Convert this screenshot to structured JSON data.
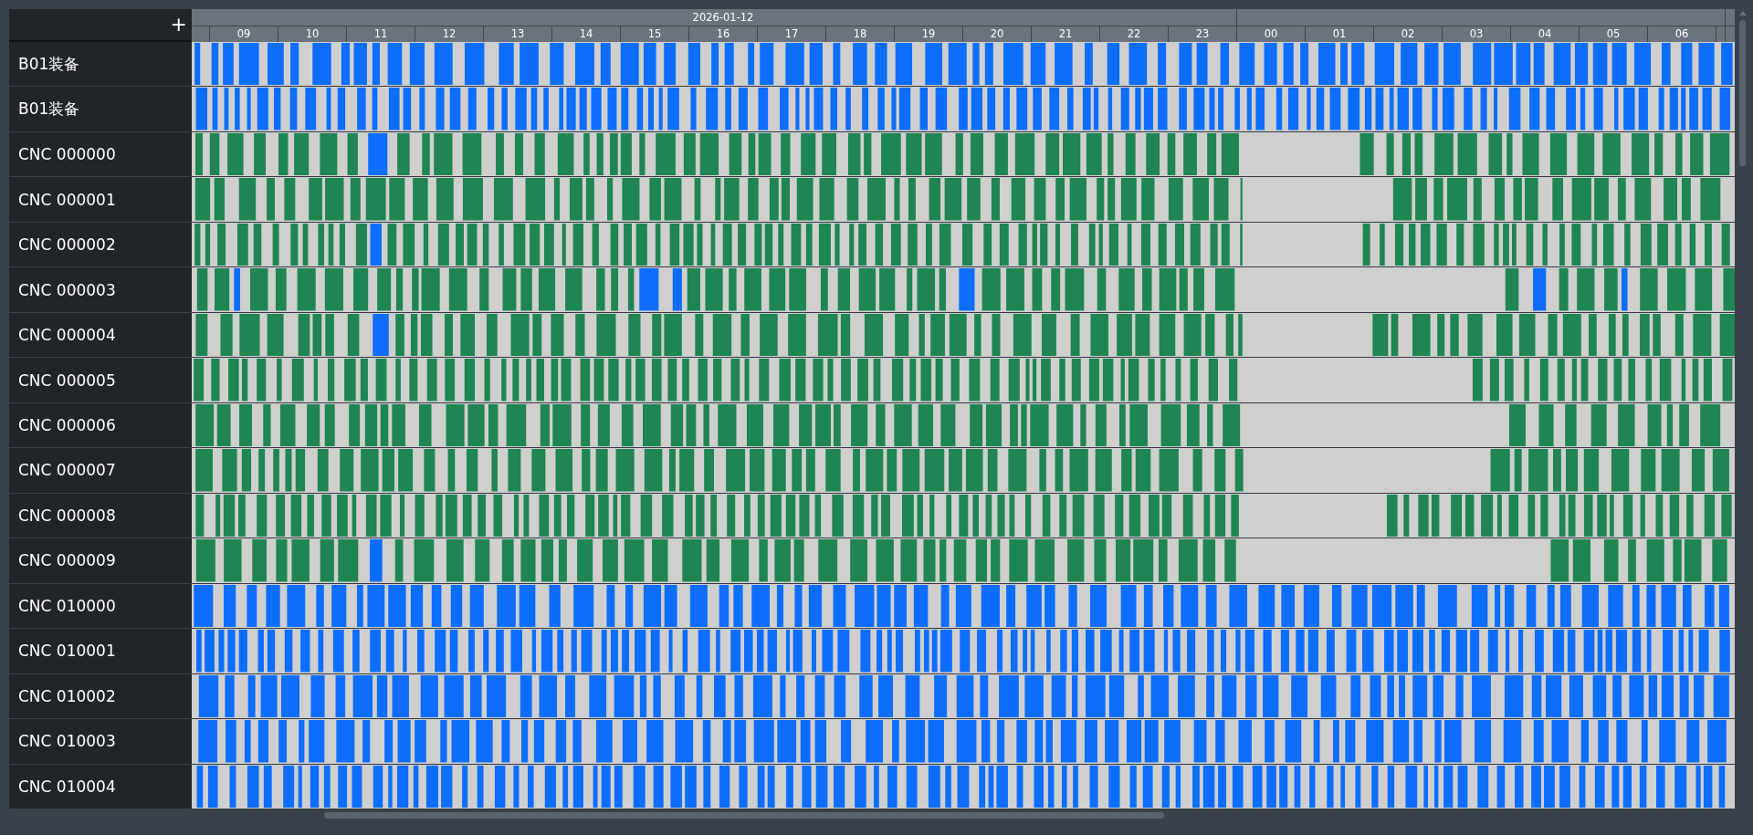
{
  "corner_button": {
    "label": "+"
  },
  "days": [
    {
      "label": "2026-01-12",
      "hours": [
        "09",
        "10",
        "11",
        "12",
        "13",
        "14",
        "15",
        "16",
        "17",
        "18",
        "19",
        "20",
        "21",
        "22",
        "23"
      ]
    },
    {
      "hours": [
        "00",
        "01",
        "02",
        "03",
        "04",
        "05",
        "06"
      ]
    }
  ],
  "rows": [
    {
      "name": "B01装备",
      "color": "#0d6efd"
    },
    {
      "name": "B01装备",
      "color": "#0d6efd"
    },
    {
      "name": "CNC 000000",
      "color": "#1e8553"
    },
    {
      "name": "CNC 000001",
      "color": "#1e8553"
    },
    {
      "name": "CNC 000002",
      "color": "#1e8553"
    },
    {
      "name": "CNC 000003",
      "color": "#1e8553"
    },
    {
      "name": "CNC 000004",
      "color": "#1e8553"
    },
    {
      "name": "CNC 000005",
      "color": "#1e8553"
    },
    {
      "name": "CNC 000006",
      "color": "#1e8553"
    },
    {
      "name": "CNC 000007",
      "color": "#1e8553"
    },
    {
      "name": "CNC 000008",
      "color": "#1e8553"
    },
    {
      "name": "CNC 000009",
      "color": "#1e8553"
    },
    {
      "name": "CNC 010000",
      "color": "#0d6efd"
    },
    {
      "name": "CNC 010001",
      "color": "#0d6efd"
    },
    {
      "name": "CNC 010002",
      "color": "#0d6efd"
    },
    {
      "name": "CNC 010003",
      "color": "#0d6efd"
    },
    {
      "name": "CNC 010004",
      "color": "#0d6efd"
    }
  ]
}
